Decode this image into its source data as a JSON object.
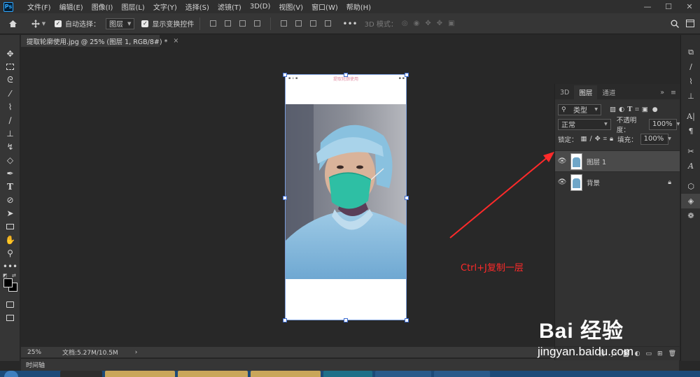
{
  "app": {
    "logo": "Ps"
  },
  "menu": [
    "文件(F)",
    "编辑(E)",
    "图像(I)",
    "图层(L)",
    "文字(Y)",
    "选择(S)",
    "滤镜(T)",
    "3D(D)",
    "视图(V)",
    "窗口(W)",
    "帮助(H)"
  ],
  "window_controls": {
    "minimize": "—",
    "maximize": "☐",
    "close": "✕"
  },
  "options": {
    "auto_select_label": "自动选择：",
    "auto_select_target": "图层",
    "show_transform_label": "显示变换控件",
    "three_d_mode_label": "3D 模式："
  },
  "document": {
    "tab_title": "提取轮廓使用.jpg @ 25% (图层 1, RGB/8#) *",
    "tab_close": "×",
    "image_header_text": "提取轮廓使用"
  },
  "status": {
    "zoom": "25%",
    "doc_info": "文档:5.27M/10.5M",
    "arrow": "›"
  },
  "timeline_label": "时间轴",
  "layers_panel": {
    "tabs": [
      "3D",
      "图层",
      "通道"
    ],
    "active_tab": "图层",
    "filter_label": "类型",
    "blend_mode": "正常",
    "opacity_label": "不透明度：",
    "opacity_value": "100%",
    "lock_label": "锁定：",
    "fill_label": "填充：",
    "fill_value": "100%",
    "layers": [
      {
        "name": "图层 1",
        "selected": true,
        "locked": false
      },
      {
        "name": "背景",
        "selected": false,
        "locked": true
      }
    ]
  },
  "annotation": {
    "text": "Ctrl+J复制一层",
    "color": "#ff2a2a"
  },
  "watermark": {
    "brand": "Bai 经验",
    "url": "jingyan.baidu.com"
  },
  "colors": {
    "accent": "#31a8ff",
    "selection": "#3b6ad0",
    "annotation": "#ff2a2a",
    "taskbar": "#1c4a78"
  }
}
